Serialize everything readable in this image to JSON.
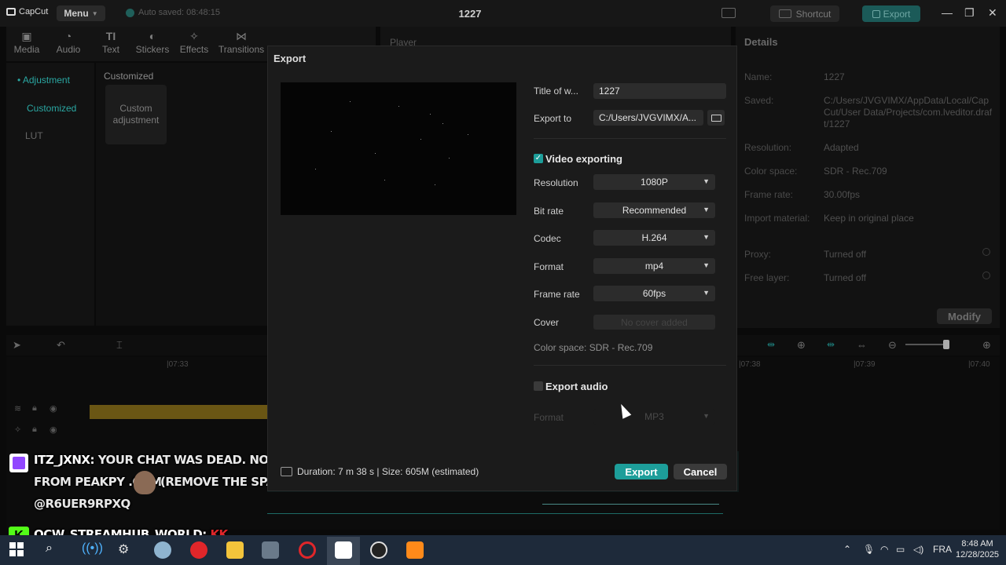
{
  "app": {
    "name": "CapCut",
    "menu_label": "Menu",
    "autosave": "Auto saved: 08:48:15",
    "project_title": "1227",
    "shortcut_label": "Shortcut",
    "export_label": "Export"
  },
  "toolbar": {
    "items": [
      {
        "label": "Media",
        "icon": "media-icon"
      },
      {
        "label": "Audio",
        "icon": "audio-icon"
      },
      {
        "label": "Text",
        "icon": "text-icon"
      },
      {
        "label": "Stickers",
        "icon": "stickers-icon"
      },
      {
        "label": "Effects",
        "icon": "effects-icon"
      },
      {
        "label": "Transitions",
        "icon": "transitions-icon"
      }
    ]
  },
  "sidebar": {
    "items": [
      {
        "label": "• Adjustment"
      },
      {
        "label": "Customized"
      },
      {
        "label": "LUT"
      }
    ]
  },
  "panel": {
    "heading": "Customized",
    "card_label": "Custom adjustment"
  },
  "player": {
    "label": "Player"
  },
  "details": {
    "title": "Details",
    "rows": [
      {
        "label": "Name:",
        "value": "1227"
      },
      {
        "label": "Saved:",
        "value": "C:/Users/JVGVIMX/AppData/Local/CapCut/User Data/Projects/com.lveditor.draft/1227"
      },
      {
        "label": "Resolution:",
        "value": "Adapted"
      },
      {
        "label": "Color space:",
        "value": "SDR - Rec.709"
      },
      {
        "label": "Frame rate:",
        "value": "30.00fps"
      },
      {
        "label": "Import material:",
        "value": "Keep in original place"
      },
      {
        "label": "Proxy:",
        "value": "Turned off"
      },
      {
        "label": "Free layer:",
        "value": "Turned off"
      }
    ],
    "modify_label": "Modify"
  },
  "timeline": {
    "ruler_labels": [
      "|07:33",
      "|07:38",
      "|07:39",
      "|07:40"
    ]
  },
  "overlay": {
    "chat1_user": "ITZ_JXNX:",
    "chat1_line1": "YOUR CHAT WAS DEAD. NOW IT'S LIT, ALL",
    "chat1_line2": "FROM PEAKPY .COM",
    "chat1_line3": "(REMOVE THE SPACE)",
    "chat1_line4": "@R6UER9RPXQ",
    "chat2_user": "OCW_STREAMHUB_WORLD:",
    "chat2_msg": "KK",
    "kick_letter": "K"
  },
  "dialog": {
    "title": "Export",
    "title_label": "Title of w...",
    "title_value": "1227",
    "export_to_label": "Export to",
    "export_to_value": "C:/Users/JVGVIMX/A...",
    "video_section": "Video exporting",
    "video_checked": true,
    "settings": [
      {
        "label": "Resolution",
        "value": "1080P"
      },
      {
        "label": "Bit rate",
        "value": "Recommended"
      },
      {
        "label": "Codec",
        "value": "H.264"
      },
      {
        "label": "Format",
        "value": "mp4"
      },
      {
        "label": "Frame rate",
        "value": "60fps"
      }
    ],
    "cover_label": "Cover",
    "cover_button": "No cover added",
    "color_space": "Color space: SDR - Rec.709",
    "audio_section": "Export audio",
    "audio_checked": false,
    "audio_format_label": "Format",
    "audio_format_value": "MP3",
    "footer_info": "Duration: 7 m 38 s | Size: 605M (estimated)",
    "export_button": "Export",
    "cancel_button": "Cancel"
  },
  "taskbar": {
    "language": "FRA",
    "time": "8:48 AM",
    "date": "12/28/2025"
  },
  "colors": {
    "accent": "#1d9e9a",
    "dialog_bg": "#1b1b1b",
    "twitch": "#9147ff",
    "kick": "#53fc18"
  }
}
